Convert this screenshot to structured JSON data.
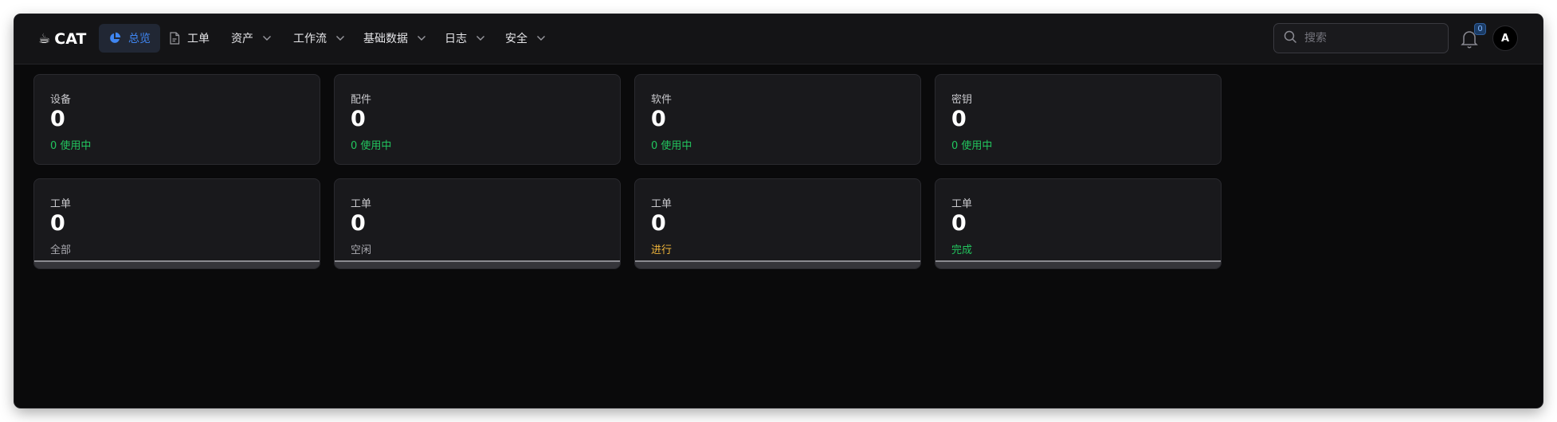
{
  "app": {
    "logo_icon": "coffee-cup-icon",
    "name": "CAT"
  },
  "nav": {
    "overview": "总览",
    "workorder": "工单",
    "assets": "资产",
    "workflow": "工作流",
    "basedata": "基础数据",
    "logs": "日志",
    "security": "安全"
  },
  "search": {
    "placeholder": "搜索"
  },
  "notifications": {
    "count": "0"
  },
  "user": {
    "avatar_letter": "A"
  },
  "colors": {
    "accent": "#3f86f2",
    "success": "#22c55e",
    "warning": "#f0b53a"
  },
  "asset_cards": [
    {
      "label": "设备",
      "value": "0",
      "sub": "0 使用中"
    },
    {
      "label": "配件",
      "value": "0",
      "sub": "0 使用中"
    },
    {
      "label": "软件",
      "value": "0",
      "sub": "0 使用中"
    },
    {
      "label": "密钥",
      "value": "0",
      "sub": "0 使用中"
    }
  ],
  "workorder_cards": [
    {
      "label": "工单",
      "value": "0",
      "sub": "全部",
      "progress": 0
    },
    {
      "label": "工单",
      "value": "0",
      "sub": "空闲",
      "progress": 0
    },
    {
      "label": "工单",
      "value": "0",
      "sub": "进行",
      "progress": 0
    },
    {
      "label": "工单",
      "value": "0",
      "sub": "完成",
      "progress": 0
    }
  ]
}
